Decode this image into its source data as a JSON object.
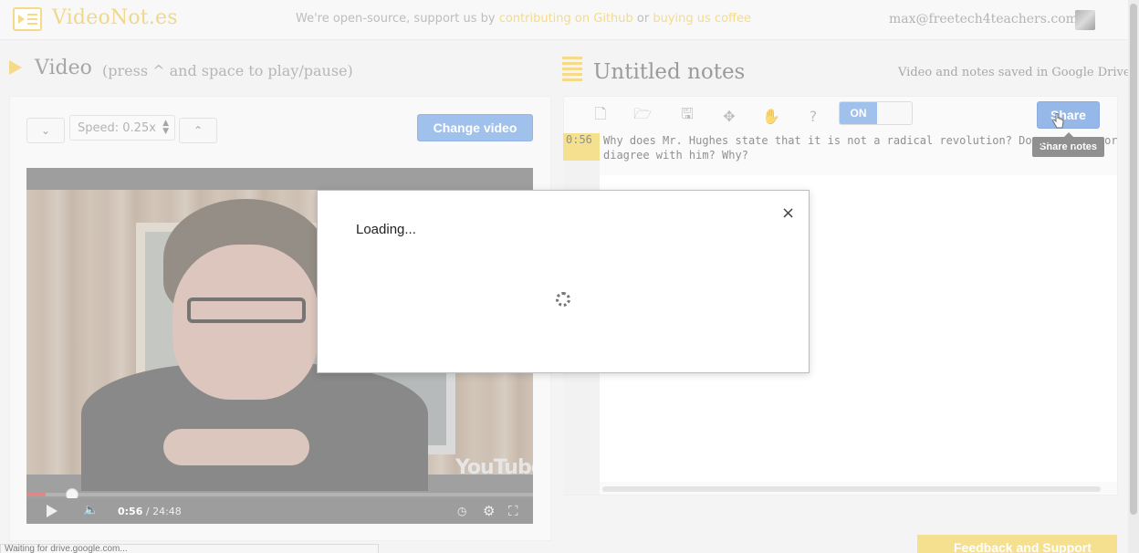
{
  "header": {
    "logo_text": "VideoNot.es",
    "banner_prefix": "We're open-source, support us by",
    "banner_link1": "contributing on Github",
    "banner_mid": "or",
    "banner_link2": "buying us coffee",
    "user_email": "max@freetech4teachers.com"
  },
  "video_panel": {
    "title": "Video",
    "hint": "(press ^ and space to play/pause)",
    "speed_label": "Speed: 0.25x",
    "change_video_label": "Change video",
    "player": {
      "current_time": "0:56",
      "total_time": "24:48",
      "progress_fraction": 0.038,
      "youtube_logo": "YouTube"
    }
  },
  "notes_panel": {
    "title": "Untitled notes",
    "saved_text": "Video and notes saved in Google Drive",
    "toggle_label": "ON",
    "share_label": "Share",
    "share_tooltip": "Share notes",
    "note": {
      "timestamp": "0:56",
      "text": "Why does Mr. Hughes state that it is not a radical revolution? Do you agree or diagree with him? Why?"
    }
  },
  "modal": {
    "title": "Loading...",
    "close_icon": "×"
  },
  "feedback_label": "Feedback and Support",
  "status_bar": "Waiting for drive.google.com...",
  "colors": {
    "accent_yellow": "#f0c84a",
    "button_blue": "#6fa0e3"
  }
}
